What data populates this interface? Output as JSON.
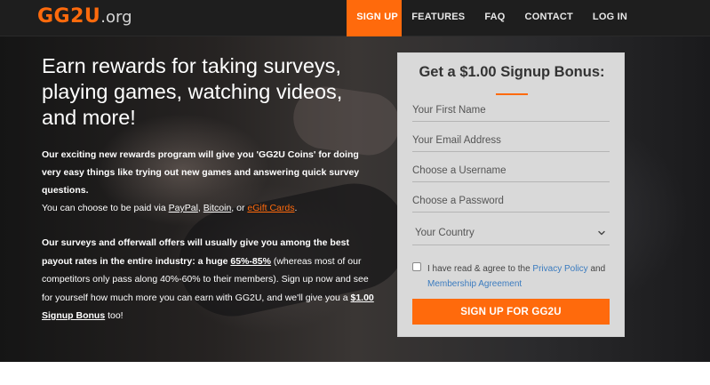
{
  "nav": {
    "logo_main": "GG2U",
    "logo_suffix": ".org",
    "links": {
      "signup": "SIGN UP",
      "features": "FEATURES",
      "faq": "FAQ",
      "contact": "CONTACT",
      "login": "LOG IN"
    },
    "active": "SIGN UP"
  },
  "hero": {
    "heading": "Earn rewards for taking surveys, playing games, watching videos, and more!",
    "p1": "Our exciting new rewards program will give you 'GG2U Coins' for doing very easy things like trying out new games and answering quick survey questions.",
    "p2": {
      "prefix": "You can choose to be paid via ",
      "paypal": "PayPal",
      "sep1": ", ",
      "bitcoin": "Bitcoin",
      "sep2": ", or ",
      "egift": "eGift Cards",
      "suffix": "."
    },
    "p3": {
      "part1": "Our surveys and offerwall offers will usually give you among the best payout rates in the entire industry: a huge ",
      "highlight": "65%-85%",
      "part2": " (whereas most of our competitors only pass along 40%-60% to their members). Sign up now and see for yourself how much more you can earn with GG2U, and we'll give you a ",
      "bonus": "$1.00 Signup Bonus",
      "part3": " too!"
    }
  },
  "signup": {
    "title": "Get a $1.00 Signup Bonus:",
    "first_name_placeholder": "Your First Name",
    "email_placeholder": "Your Email Address",
    "username_placeholder": "Choose a Username",
    "password_placeholder": "Choose a Password",
    "country_selected": "Your Country",
    "agree_prefix": "I have read & agree to the ",
    "privacy_link": "Privacy Policy",
    "agree_mid": " and ",
    "membership_link": "Membership Agreement",
    "submit_label": "SIGN UP FOR GG2U"
  },
  "colors": {
    "accent": "#ff6a0c",
    "nav_bg": "#1e1e1e",
    "card_bg": "#d9d9d9",
    "link_blue": "#3a7bbf"
  },
  "icons": {
    "country_dropdown": "chevron-down-icon"
  }
}
